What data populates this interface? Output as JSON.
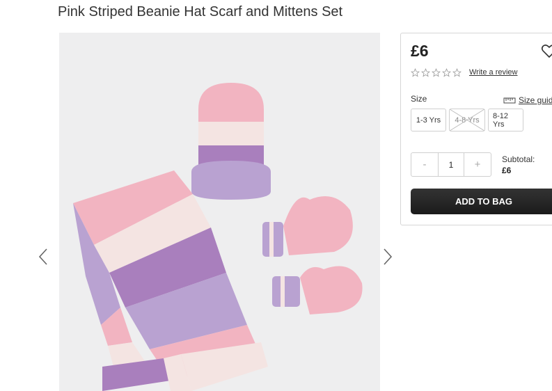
{
  "product": {
    "title": "Pink Striped Beanie Hat Scarf and Mittens Set"
  },
  "gallery": {
    "prev_icon": "chevron-left-icon",
    "next_icon": "chevron-right-icon"
  },
  "buybox": {
    "price": "£6",
    "wishlist_icon": "heart-icon",
    "rating": {
      "value": 0,
      "max": 5,
      "review_link": "Write a review"
    },
    "size": {
      "label": "Size",
      "guide_label": "Size guid",
      "guide_icon": "ruler-icon",
      "options": [
        {
          "label": "1-3 Yrs",
          "available": true
        },
        {
          "label": "4-8 Yrs",
          "available": false
        },
        {
          "label": "8-12 Yrs",
          "available": true
        }
      ]
    },
    "quantity": {
      "minus": "-",
      "value": "1",
      "plus": "+"
    },
    "subtotal": {
      "label": "Subtotal:",
      "value": "£6"
    },
    "add_to_bag": "ADD TO BAG"
  },
  "colors": {
    "pink": "#f2b4c1",
    "cream": "#f4e4e2",
    "purple": "#a97fbd",
    "lilac": "#b9a2d1",
    "button": "#222222"
  }
}
